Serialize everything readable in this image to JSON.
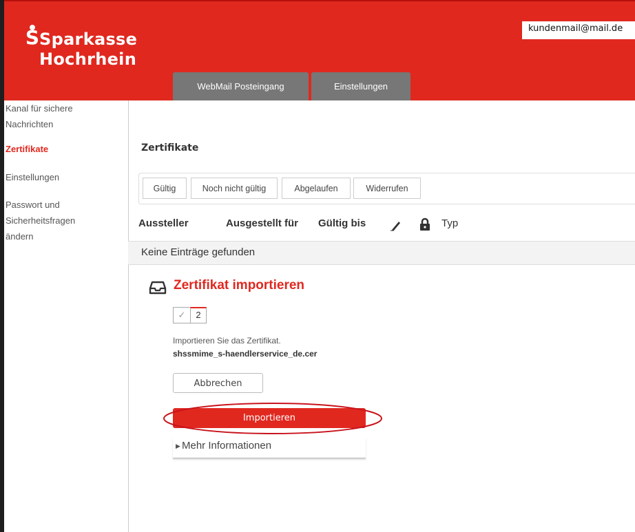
{
  "brand": {
    "line1": "Sparkasse",
    "line2": "Hochrhein",
    "s_glyph": "S",
    "color": "#e0281f"
  },
  "header": {
    "email": "kundenmail@mail.de"
  },
  "tabs": [
    {
      "label": "WebMail Posteingang"
    },
    {
      "label": "Einstellungen"
    }
  ],
  "sidebar": {
    "items": [
      {
        "label_line1": "Kanal für sichere",
        "label_line2": "Nachrichten"
      },
      {
        "label": "Zertifikate"
      },
      {
        "label": "Einstellungen"
      },
      {
        "label_line1": "Passwort und",
        "label_line2": "Sicherheitsfragen",
        "label_line3": "ändern"
      }
    ]
  },
  "main": {
    "title": "Zertifikate",
    "filters": [
      "Gültig",
      "Noch nicht gültig",
      "Abgelaufen",
      "Widerrufen"
    ],
    "columns": {
      "issuer": "Aussteller",
      "issued_to": "Ausgestellt für",
      "valid_until": "Gültig bis",
      "type": "Typ",
      "sign_icon": "pen-icon",
      "lock_icon": "lock-icon"
    },
    "empty_message": "Keine Einträge gefunden"
  },
  "import": {
    "title": "Zertifikat importieren",
    "icon": "inbox-icon",
    "step_done": "✓",
    "step_current": "2",
    "hint": "Importieren Sie das Zertifikat.",
    "filename": "shssmime_s-haendlerservice_de.cer",
    "cancel_label": "Abbrechen",
    "import_label": "Importieren",
    "more_info_label": "Mehr Informationen"
  }
}
